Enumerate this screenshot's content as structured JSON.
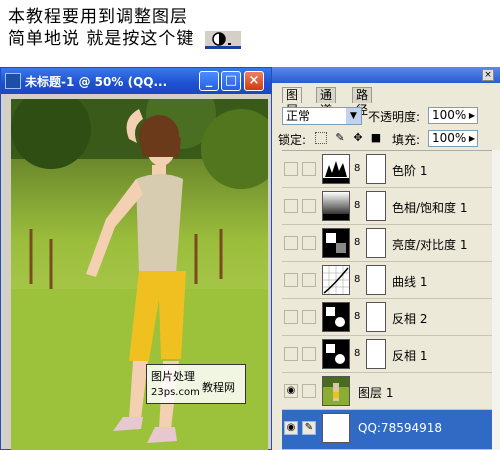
{
  "intro": {
    "line1": "本教程要用到调整图层",
    "line2": "简单地说 就是按这个键"
  },
  "document_window": {
    "title": "未标题-1 @ 50% (QQ...",
    "buttons": [
      "minimize",
      "maximize",
      "close"
    ],
    "watermark": {
      "line1": "图片处理",
      "line2": "23ps.com",
      "line3": "教程网"
    }
  },
  "layers_panel": {
    "tabs": [
      "图层",
      "通道",
      "路径"
    ],
    "blend_mode": "正常",
    "opacity_label": "不透明度:",
    "opacity_value": "100%",
    "lock_label": "锁定:",
    "fill_label": "填充:",
    "fill_value": "100%",
    "layers": [
      {
        "name": "色阶 1",
        "icon": "levels-icon"
      },
      {
        "name": "色相/饱和度 1",
        "icon": "hue-saturation-icon"
      },
      {
        "name": "亮度/对比度 1",
        "icon": "brightness-contrast-icon"
      },
      {
        "name": "曲线 1",
        "icon": "curves-icon"
      },
      {
        "name": "反相 2",
        "icon": "invert-icon"
      },
      {
        "name": "反相 1",
        "icon": "invert-icon"
      },
      {
        "name": "图层 1",
        "icon": "photo-thumbnail"
      },
      {
        "name": "QQ:78594918",
        "icon": "blank-thumbnail"
      }
    ]
  }
}
